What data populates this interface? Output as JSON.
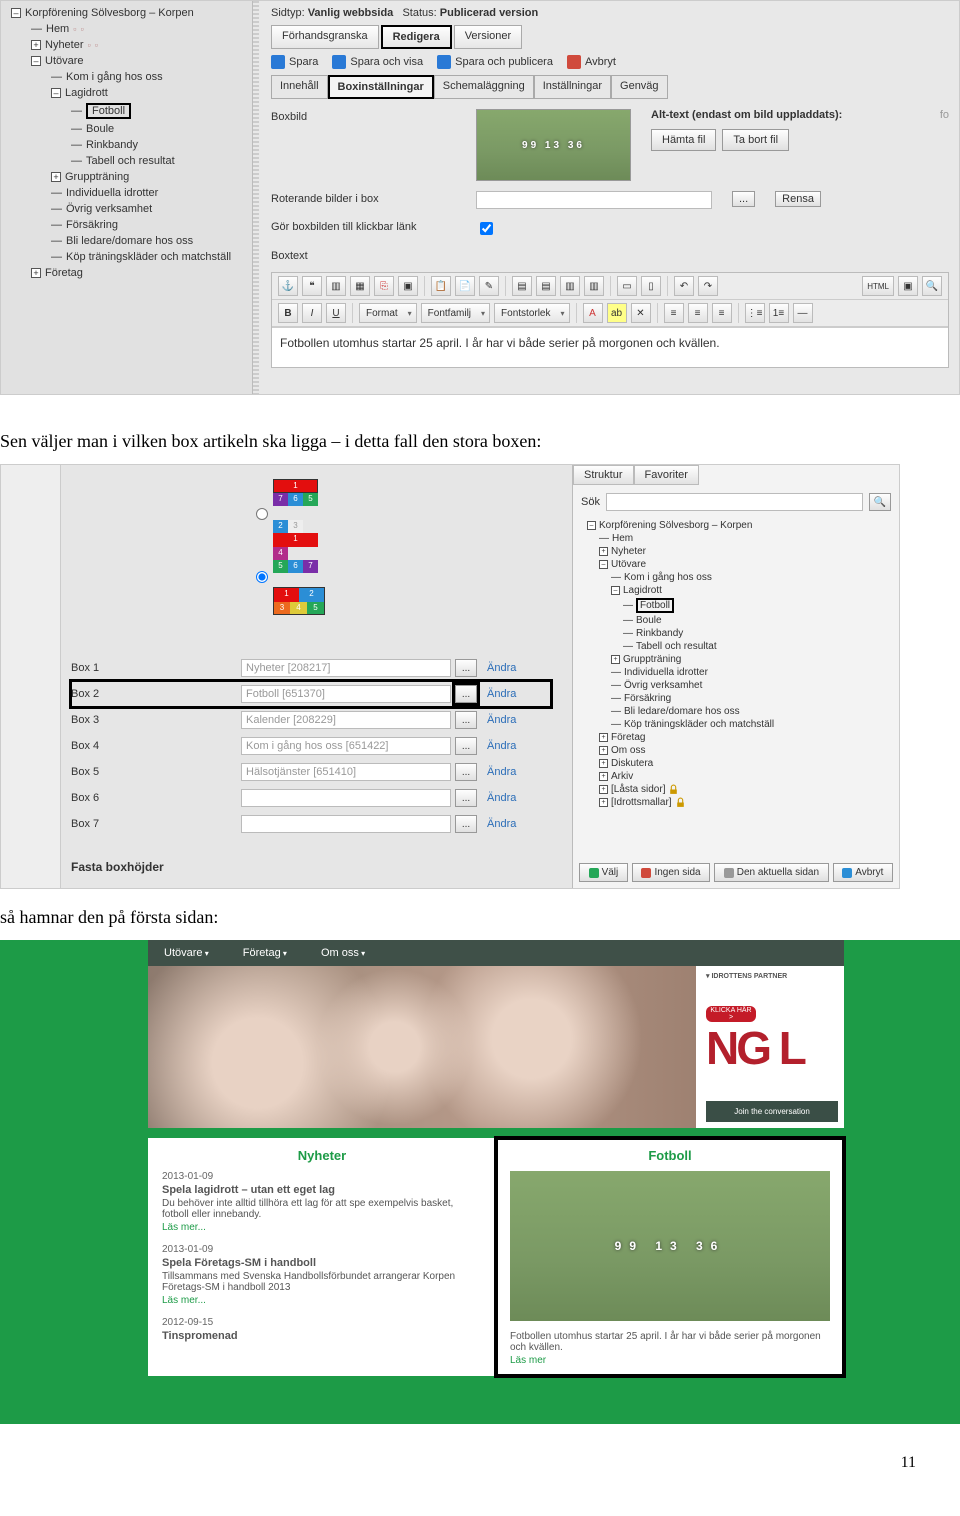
{
  "treeA": {
    "root": "Korpförening Sölvesborg – Korpen",
    "hem": "Hem",
    "nyheter": "Nyheter",
    "utovare": "Utövare",
    "kom": "Kom i gång hos oss",
    "lagidrott": "Lagidrott",
    "fotboll": "Fotboll",
    "boule": "Boule",
    "rinkbandy": "Rinkbandy",
    "tabell": "Tabell och resultat",
    "grupp": "Gruppträning",
    "individ": "Individuella idrotter",
    "ovrig": "Övrig verksamhet",
    "forsakring": "Försäkring",
    "ledare": "Bli ledare/domare hos oss",
    "kop": "Köp träningskläder och matchställ",
    "foretag": "Företag"
  },
  "header": {
    "sidtyp_l": "Sidtyp:",
    "sidtyp_v": "Vanlig webbsida",
    "status_l": "Status:",
    "status_v": "Publicerad version"
  },
  "tabs1": {
    "preview": "Förhandsgranska",
    "edit": "Redigera",
    "versions": "Versioner"
  },
  "toolbar1": {
    "save": "Spara",
    "saveshow": "Spara och visa",
    "savepub": "Spara och publicera",
    "cancel": "Avbryt"
  },
  "tabs2": {
    "innehall": "Innehåll",
    "boxinst": "Boxinställningar",
    "schema": "Schemaläggning",
    "installningar": "Inställningar",
    "genvag": "Genväg"
  },
  "form": {
    "boxbild": "Boxbild",
    "alttext": "Alt-text (endast om bild uppladdats):",
    "alttext_val": "fo",
    "hamta": "Hämta fil",
    "tabort": "Ta bort fil",
    "rot": "Roterande bilder i box",
    "klick": "Gör boxbilden till klickbar länk",
    "boxtext": "Boxtext",
    "browse": "...",
    "rensa": "Rensa"
  },
  "rte": {
    "format": "Format",
    "fontfamilj": "Fontfamilj",
    "fontstorlek": "Fontstorlek",
    "html": "HTML",
    "content": "Fotbollen utomhus startar 25 april. I år har vi både serier på morgonen och kvällen."
  },
  "narr1": "Sen väljer man i vilken box artikeln ska ligga – i detta fall den stora boxen:",
  "narr2": "så hamnar den på första sidan:",
  "boxsel": {
    "tabs": {
      "struktur": "Struktur",
      "favoriter": "Favoriter"
    },
    "sok": "Sök",
    "sok_btn": "🔍",
    "buttons": {
      "valj": "Välj",
      "ingen": "Ingen sida",
      "aktuell": "Den aktuella sidan",
      "avbryt": "Avbryt"
    },
    "rows": [
      {
        "l": "Box 1",
        "v": "Nyheter [208217]"
      },
      {
        "l": "Box 2",
        "v": "Fotboll [651370]"
      },
      {
        "l": "Box 3",
        "v": "Kalender [208229]"
      },
      {
        "l": "Box 4",
        "v": "Kom i gång hos oss [651422]"
      },
      {
        "l": "Box 5",
        "v": "Hälsotjänster [651410]"
      },
      {
        "l": "Box 6",
        "v": ""
      },
      {
        "l": "Box 7",
        "v": ""
      }
    ],
    "andra": "Ändra",
    "fixed_heading": "Fasta boxhöjder"
  },
  "treeB": {
    "root": "Korpförening Sölvesborg – Korpen",
    "hem": "Hem",
    "nyheter": "Nyheter",
    "utovare": "Utövare",
    "kom": "Kom i gång hos oss",
    "lagidrott": "Lagidrott",
    "fotboll": "Fotboll",
    "boule": "Boule",
    "rinkbandy": "Rinkbandy",
    "tabell": "Tabell och resultat",
    "grupp": "Gruppträning",
    "individ": "Individuella idrotter",
    "ovrig": "Övrig verksamhet",
    "forsakring": "Försäkring",
    "ledare": "Bli ledare/domare hos oss",
    "kop": "Köp träningskläder och matchställ",
    "foretag": "Företag",
    "omoss": "Om oss",
    "diskutera": "Diskutera",
    "arkiv": "Arkiv",
    "lasta": "[Låsta sidor]",
    "idrotts": "[Idrottsmallar]"
  },
  "front": {
    "nav": {
      "utovare": "Utövare",
      "foretag": "Företag",
      "omoss": "Om oss"
    },
    "partner": "IDROTTENS PARTNER",
    "klicka": "KLICKA HÄR >",
    "logo": "NG L",
    "join": "Join the conversation",
    "nyheter": {
      "head": "Nyheter",
      "d1": "2013-01-09",
      "t1": "Spela lagidrott – utan ett eget lag",
      "p1": "Du behöver inte alltid tillhöra ett lag för att spe exempelvis basket, fotboll eller innebandy.",
      "ls": "Läs mer...",
      "d2": "2013-01-09",
      "t2": "Spela Företags-SM i handboll",
      "p2": "Tillsammans med Svenska Handbollsförbundet arrangerar Korpen Företags-SM i handboll 2013",
      "d3": "2012-09-15",
      "t3": "Tinspromenad"
    },
    "fotboll": {
      "head": "Fotboll",
      "p": "Fotbollen utomhus startar 25 april. I år har vi både serier på morgonen och kvällen.",
      "ls": "Läs mer"
    }
  },
  "page_no": "11"
}
